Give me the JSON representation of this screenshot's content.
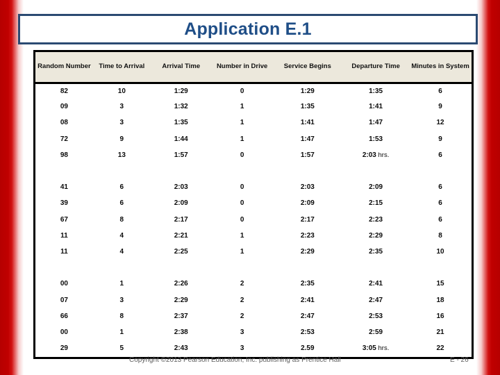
{
  "slide": {
    "title": "Application E.1",
    "accent_border_color": "#2b4a72",
    "title_color": "#1f4e87",
    "header_fill_color": "#ece8dc",
    "edge_band_color": "#c00000"
  },
  "table": {
    "headers": [
      "Random Number",
      "Time to Arrival",
      "Arrival Time",
      "Number in Drive",
      "Service Begins",
      "Departure Time",
      "Minutes in System"
    ],
    "groups": [
      {
        "rows": [
          {
            "random_number": "82",
            "time_to_arrival": "10",
            "arrival_time": "1:29",
            "number_in_drive": "0",
            "service_begins": "1:29",
            "departure_time": "1:35",
            "departure_suffix": "",
            "minutes_in_system": "6"
          },
          {
            "random_number": "09",
            "time_to_arrival": "3",
            "arrival_time": "1:32",
            "number_in_drive": "1",
            "service_begins": "1:35",
            "departure_time": "1:41",
            "departure_suffix": "",
            "minutes_in_system": "9"
          },
          {
            "random_number": "08",
            "time_to_arrival": "3",
            "arrival_time": "1:35",
            "number_in_drive": "1",
            "service_begins": "1:41",
            "departure_time": "1:47",
            "departure_suffix": "",
            "minutes_in_system": "12"
          },
          {
            "random_number": "72",
            "time_to_arrival": "9",
            "arrival_time": "1:44",
            "number_in_drive": "1",
            "service_begins": "1:47",
            "departure_time": "1:53",
            "departure_suffix": "",
            "minutes_in_system": "9"
          },
          {
            "random_number": "98",
            "time_to_arrival": "13",
            "arrival_time": "1:57",
            "number_in_drive": "0",
            "service_begins": "1:57",
            "departure_time": "2:03",
            "departure_suffix": " hrs.",
            "minutes_in_system": "6"
          }
        ]
      },
      {
        "rows": [
          {
            "random_number": "41",
            "time_to_arrival": "6",
            "arrival_time": "2:03",
            "number_in_drive": "0",
            "service_begins": "2:03",
            "departure_time": "2:09",
            "departure_suffix": "",
            "minutes_in_system": "6"
          },
          {
            "random_number": "39",
            "time_to_arrival": "6",
            "arrival_time": "2:09",
            "number_in_drive": "0",
            "service_begins": "2:09",
            "departure_time": "2:15",
            "departure_suffix": "",
            "minutes_in_system": "6"
          },
          {
            "random_number": "67",
            "time_to_arrival": "8",
            "arrival_time": "2:17",
            "number_in_drive": "0",
            "service_begins": "2:17",
            "departure_time": "2:23",
            "departure_suffix": "",
            "minutes_in_system": "6"
          },
          {
            "random_number": "11",
            "time_to_arrival": "4",
            "arrival_time": "2:21",
            "number_in_drive": "1",
            "service_begins": "2:23",
            "departure_time": "2:29",
            "departure_suffix": "",
            "minutes_in_system": "8"
          },
          {
            "random_number": "11",
            "time_to_arrival": "4",
            "arrival_time": "2:25",
            "number_in_drive": "1",
            "service_begins": "2:29",
            "departure_time": "2:35",
            "departure_suffix": "",
            "minutes_in_system": "10"
          }
        ]
      },
      {
        "rows": [
          {
            "random_number": "00",
            "time_to_arrival": "1",
            "arrival_time": "2:26",
            "number_in_drive": "2",
            "service_begins": "2:35",
            "departure_time": "2:41",
            "departure_suffix": "",
            "minutes_in_system": "15"
          },
          {
            "random_number": "07",
            "time_to_arrival": "3",
            "arrival_time": "2:29",
            "number_in_drive": "2",
            "service_begins": "2:41",
            "departure_time": "2:47",
            "departure_suffix": "",
            "minutes_in_system": "18"
          },
          {
            "random_number": "66",
            "time_to_arrival": "8",
            "arrival_time": "2:37",
            "number_in_drive": "2",
            "service_begins": "2:47",
            "departure_time": "2:53",
            "departure_suffix": "",
            "minutes_in_system": "16"
          },
          {
            "random_number": "00",
            "time_to_arrival": "1",
            "arrival_time": "2:38",
            "number_in_drive": "3",
            "service_begins": "2:53",
            "departure_time": "2:59",
            "departure_suffix": "",
            "minutes_in_system": "21"
          },
          {
            "random_number": "29",
            "time_to_arrival": "5",
            "arrival_time": "2:43",
            "number_in_drive": "3",
            "service_begins": "2.59",
            "departure_time": "3:05",
            "departure_suffix": " hrs.",
            "minutes_in_system": "22"
          }
        ]
      }
    ]
  },
  "footer": {
    "copyright": "Copyright ©2013 Pearson Education, Inc. publishing as Prentice Hall",
    "page_number": "E - 26"
  }
}
